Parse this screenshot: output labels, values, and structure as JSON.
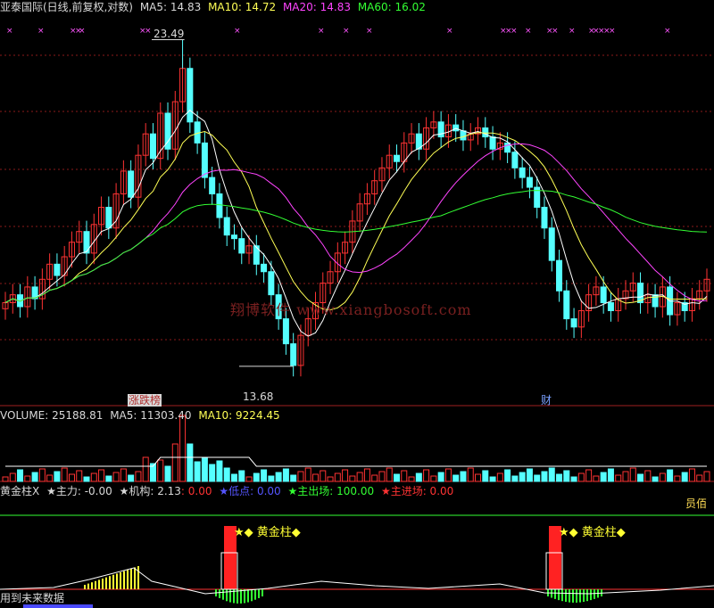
{
  "header": {
    "title": "亚泰国际(日线,前复权,对数)",
    "ma5": "MA5: 14.83",
    "ma10": "MA10: 14.72",
    "ma20": "MA20: 14.83",
    "ma60": "MA60: 16.02"
  },
  "main_panel": {
    "high_label": "23.49",
    "low_label": "13.68",
    "badge_left": "涨跌榜",
    "badge_right": "财",
    "watermark": "翔博软件 www.xiangbosoft.com"
  },
  "volume_panel": {
    "volume": "VOLUME: 25188.81",
    "ma5": "MA5: 11303.40",
    "ma10": "MA10: 9224.45"
  },
  "indicator_panel": {
    "name": "黄金柱",
    "close_mark": "X",
    "zhuli": "★主力: -0.00",
    "jigou": "★机构: 2.13",
    "jigou_extra": ": 0.00",
    "didian": "★低点: 0.00",
    "zhuchuchang": "★主出场: 100.00",
    "zhujinchang": "★主进场: 0.00",
    "right_tag": "员佰",
    "signal_label_1": "★◆ 黄金柱◆",
    "signal_label_2": "★◆ 黄金柱◆",
    "footer": "用到未来数据"
  },
  "colors": {
    "up": "#ff3333",
    "down": "#55ffff",
    "ma5": "#ffffff",
    "ma10": "#ffff55",
    "ma20": "#ff44ff",
    "ma60": "#33ff33",
    "grid": "#8b1a1a"
  },
  "chart_data": {
    "type": "candlestick",
    "series": [
      {
        "name": "K",
        "values": [
          15.2,
          15.4,
          15.1,
          15.6,
          15.3,
          15.8,
          16.2,
          15.9,
          16.4,
          16.8,
          17.1,
          16.5,
          17.3,
          17.8,
          17.2,
          18.2,
          18.9,
          18.1,
          19.4,
          20.1,
          19.3,
          20.8,
          19.6,
          21.2,
          22.4,
          20.5,
          19.8,
          18.7,
          18.2,
          17.5,
          17.0,
          16.9,
          16.5,
          16.7,
          16.2,
          16.0,
          15.4,
          14.8,
          14.2,
          13.7,
          14.4,
          14.8,
          15.2,
          15.7,
          16.0,
          16.5,
          16.8,
          17.4,
          17.9,
          18.2,
          18.6,
          19.0,
          19.4,
          19.2,
          19.8,
          20.1,
          19.6,
          20.3,
          20.5,
          20.0,
          20.4,
          20.2,
          19.9,
          20.1,
          20.3,
          20.0,
          19.6,
          19.8,
          19.5,
          19.0,
          18.7,
          18.4,
          17.8,
          17.2,
          16.3,
          15.5,
          14.8,
          14.6,
          15.0,
          15.4,
          15.6,
          15.2,
          15.0,
          15.3,
          15.5,
          15.7,
          15.2,
          15.4,
          15.1,
          15.6,
          14.9,
          15.2,
          15.0,
          15.3,
          15.5,
          15.8
        ]
      },
      {
        "name": "MA5",
        "values": []
      },
      {
        "name": "MA10",
        "values": []
      },
      {
        "name": "MA20",
        "values": []
      },
      {
        "name": "MA60",
        "values": []
      }
    ],
    "annotations": [
      "23.49",
      "13.68"
    ]
  }
}
